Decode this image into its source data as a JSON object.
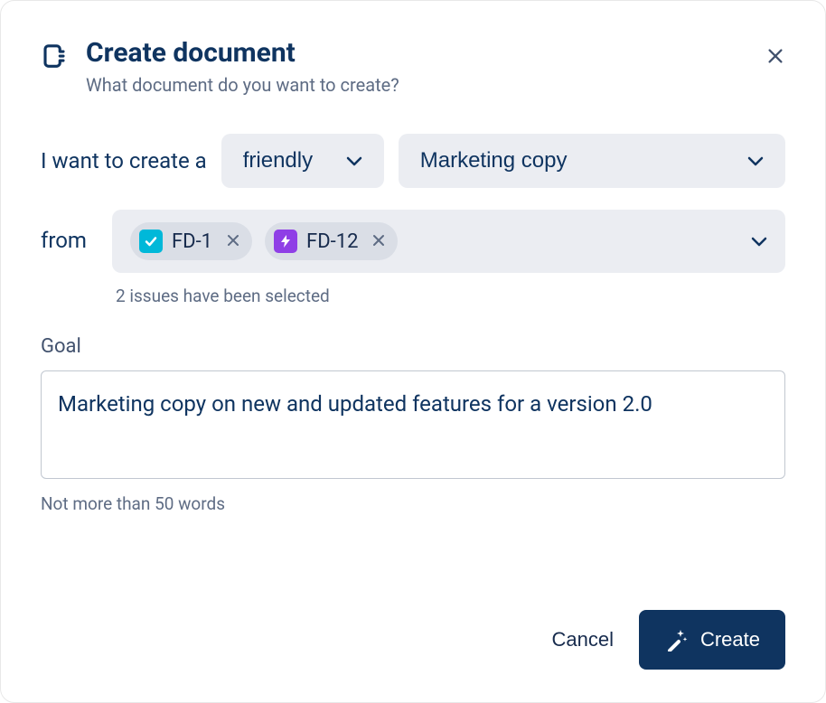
{
  "header": {
    "title": "Create document",
    "subtitle": "What document do you want to create?"
  },
  "sentence": {
    "prefix": "I want to create a",
    "tone_selected": "friendly",
    "type_selected": "Marketing copy",
    "from_label": "from"
  },
  "issues": {
    "items": [
      {
        "key": "FD-1",
        "icon_type": "check",
        "icon_bg": "blue"
      },
      {
        "key": "FD-12",
        "icon_type": "bolt",
        "icon_bg": "purple"
      }
    ],
    "helper": "2 issues have been selected"
  },
  "goal": {
    "label": "Goal",
    "value": "Marketing copy on new and updated features for a version 2.0",
    "hint": "Not more than 50 words"
  },
  "footer": {
    "cancel_label": "Cancel",
    "create_label": "Create"
  }
}
